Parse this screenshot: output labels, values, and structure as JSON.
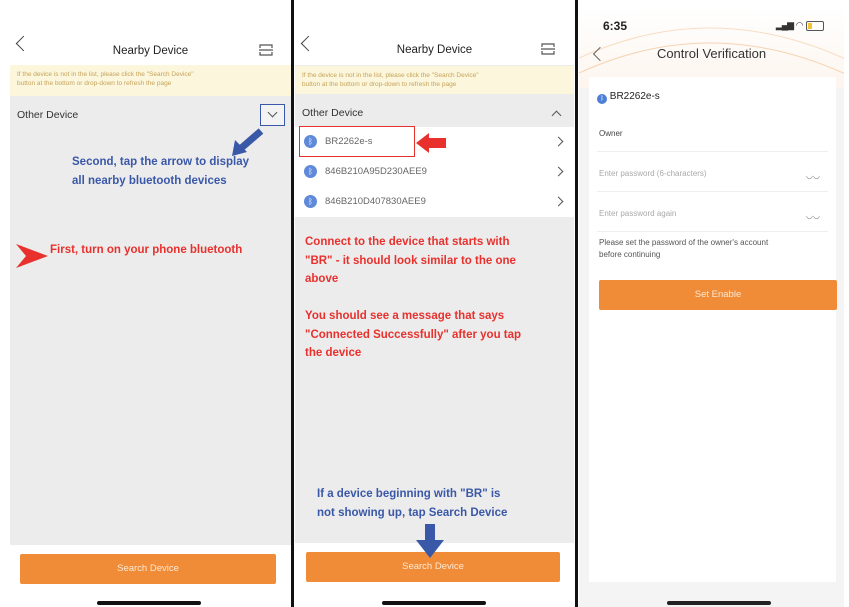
{
  "panel1": {
    "title": "Nearby Device",
    "notice_line1": "If the device is not in the list, please click the \"Search Device\"",
    "notice_line2": "button at the bottom or drop-down to refresh the page",
    "section_label": "Other Device",
    "note_second_line1": "Second, tap the arrow to display",
    "note_second_line2": "all nearby bluetooth devices",
    "note_first": "First, turn on your phone bluetooth",
    "search_button": "Search Device"
  },
  "panel2": {
    "title": "Nearby Device",
    "notice_line1": "If the device is not in the list, please click the \"Search Device\"",
    "notice_line2": "button at the bottom or drop-down to refresh the page",
    "section_label": "Other Device",
    "devices": [
      "BR2262e-s",
      "846B210A95D230AEE9",
      "846B210D407830AEE9"
    ],
    "note_connect_line1": "Connect to the device that starts with",
    "note_connect_line2": "\"BR\" - it should look similar to the one",
    "note_connect_line3": "above",
    "note_message_line1": "You should see a message that says",
    "note_message_line2": "\"Connected Successfully\" after you tap",
    "note_message_line3": "the device",
    "note_search_line1": "If a device beginning with \"BR\" is",
    "note_search_line2": "not showing up, tap Search Device",
    "search_button": "Search Device"
  },
  "panel3": {
    "time": "6:35",
    "title": "Control Verification",
    "device_name": "BR2262e-s",
    "owner_label": "Owner",
    "password_placeholder": "Enter password (6-characters)",
    "password_again_placeholder": "Enter password again",
    "hint_line1": "Please set the password of the owner's account",
    "hint_line2": "before continuing",
    "enable_button": "Set Enable"
  },
  "colors": {
    "accent": "#f08c37",
    "annotation_red": "#e8312d",
    "annotation_blue": "#3a58a8",
    "bluetooth_icon": "#5f89d9"
  }
}
